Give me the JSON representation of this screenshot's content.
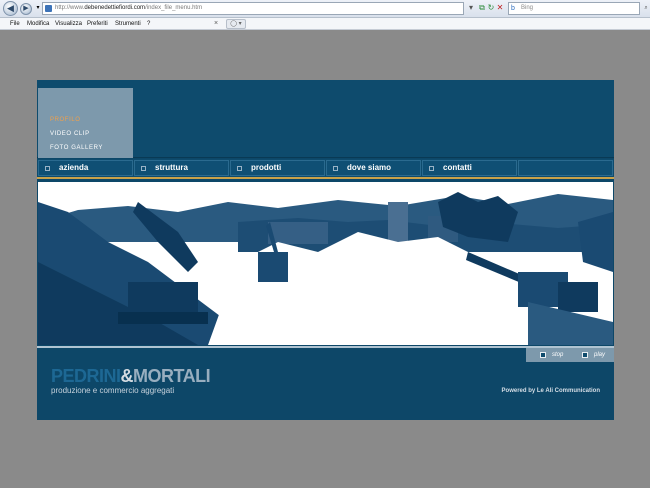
{
  "browser": {
    "back_icon": "back-arrow-icon",
    "forward_icon": "forward-arrow-icon",
    "address_prefix": "http://www.",
    "address_domain": "debenedettiefiordi.com",
    "address_path": "/index_file_menu.htm",
    "search_placeholder": "Bing",
    "tab_close": "×",
    "new_tab": "◯ ▾",
    "menu": [
      "File",
      "Modifica",
      "Visualizza",
      "Preferiti",
      "Strumenti",
      "?"
    ]
  },
  "site": {
    "submenu": [
      {
        "label": "PROFILO",
        "active": true
      },
      {
        "label": "VIDEO CLIP",
        "active": false
      },
      {
        "label": "FOTO GALLERY",
        "active": false
      }
    ],
    "nav": [
      "azienda",
      "struttura",
      "prodotti",
      "dove siamo",
      "contatti"
    ],
    "controls": {
      "stop": "stop",
      "play": "play"
    },
    "logo": {
      "part1": "PEDRINI",
      "amp": "&",
      "part2": "MORTALI"
    },
    "tagline": "produzione e commercio aggregati",
    "powered": "Powered by Le Ali Communication"
  },
  "colors": {
    "site_bg": "#0d4768",
    "submenu_bg": "#7d99ac",
    "accent": "#f0a04a",
    "page_bg": "#8a8a8a"
  }
}
